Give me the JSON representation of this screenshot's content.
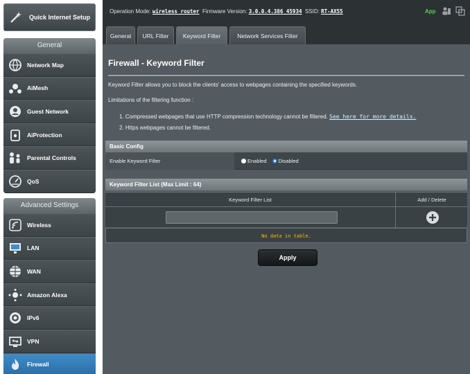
{
  "sidebar": {
    "quick_setup": {
      "label": "Quick Internet Setup",
      "icon": "wand-icon"
    },
    "general": {
      "header": "General",
      "items": [
        {
          "label": "Network Map",
          "icon": "globe-icon"
        },
        {
          "label": "AiMesh",
          "icon": "aimesh-icon"
        },
        {
          "label": "Guest Network",
          "icon": "guest-network-icon"
        },
        {
          "label": "AiProtection",
          "icon": "lock-icon"
        },
        {
          "label": "Parental Controls",
          "icon": "family-icon"
        },
        {
          "label": "QoS",
          "icon": "gauge-icon"
        }
      ]
    },
    "advanced": {
      "header": "Advanced Settings",
      "items": [
        {
          "label": "Wireless",
          "icon": "wifi-icon"
        },
        {
          "label": "LAN",
          "icon": "monitor-icon"
        },
        {
          "label": "WAN",
          "icon": "globe-icon"
        },
        {
          "label": "Amazon Alexa",
          "icon": "alexa-icon"
        },
        {
          "label": "IPv6",
          "icon": "ipv6-icon"
        },
        {
          "label": "VPN",
          "icon": "vpn-icon"
        },
        {
          "label": "Firewall",
          "icon": "firewall-icon",
          "active": true
        }
      ]
    }
  },
  "topbar": {
    "op_mode_label": "Operation Mode:",
    "op_mode_value": "wireless router",
    "fw_label": "Firmware Version:",
    "fw_value": "3.0.0.4.386_45934",
    "ssid_label": "SSID:",
    "ssid_value": "RT-AX55",
    "app_label": "App"
  },
  "tabs": [
    "General",
    "URL Filter",
    "Keyword Filter",
    "Network Services Filter"
  ],
  "active_tab": "Keyword Filter",
  "page": {
    "title": "Firewall - Keyword Filter",
    "description": "Keyword Filter allows you to block the clients' access to webpages containing the specified keywords.",
    "limitations_title": "Limitations of the filtering function :",
    "limitation_1": "1. Compressed webpages that use HTTP compression technology cannot be filtered.",
    "limitation_1_link": "See here for more details.",
    "limitation_2": "2. Https webpages cannot be filtered."
  },
  "basic_config": {
    "header": "Basic Config",
    "enable_label": "Enable Keyword Filter",
    "option_enabled": "Enabled",
    "option_disabled": "Disabled",
    "selected": "Disabled"
  },
  "keyword_list": {
    "header": "Keyword Filter List (Max Limit : 64)",
    "col_keyword": "Keyword Filter List",
    "col_action": "Add / Delete",
    "input_value": "",
    "empty_text": "No data in table."
  },
  "apply_label": "Apply",
  "colors": {
    "accent_blue": "#2d7fd0",
    "nodata_yellow": "#f0c000",
    "app_green": "#5ac85a"
  }
}
